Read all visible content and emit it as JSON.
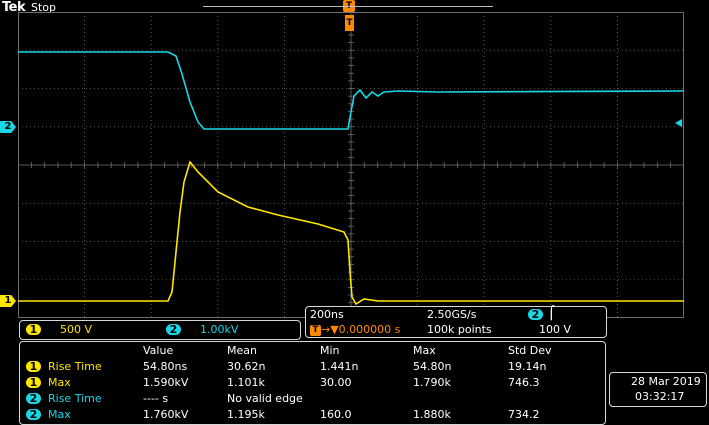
{
  "header": {
    "brand": "Tek",
    "state": "Stop"
  },
  "marker_labels": {
    "trigger": "T",
    "ch1": "1",
    "ch2": "2"
  },
  "channels": [
    {
      "num": "1",
      "scale": "500 V",
      "color": "#ffe600"
    },
    {
      "num": "2",
      "scale": "1.00kV",
      "color": "#18d8e8"
    }
  ],
  "acquisition": {
    "timebase": "200ns",
    "sample_rate": "2.50GS/s",
    "trigger_channel": "2",
    "trigger_slope_icon": "rising-edge-icon",
    "trigger_position": "→▼0.000000 s",
    "record_length": "100k points",
    "trigger_level": "100 V"
  },
  "measurements": {
    "headers": [
      "Value",
      "Mean",
      "Min",
      "Max",
      "Std Dev"
    ],
    "rows": [
      {
        "ch": "1",
        "name": "Rise Time",
        "value": "54.80ns",
        "mean": "30.62n",
        "min": "1.441n",
        "max": "54.80n",
        "std": "19.14n"
      },
      {
        "ch": "1",
        "name": "Max",
        "value": "1.590kV",
        "mean": "1.101k",
        "min": "30.00",
        "max": "1.790k",
        "std": "746.3"
      },
      {
        "ch": "2",
        "name": "Rise Time",
        "value": "---- s",
        "mean": "No valid edge",
        "min": "",
        "max": "",
        "std": ""
      },
      {
        "ch": "2",
        "name": "Max",
        "value": "1.760kV",
        "mean": "1.195k",
        "min": "160.0",
        "max": "1.880k",
        "std": "734.2"
      }
    ]
  },
  "datetime": {
    "date": "28 Mar  2019",
    "time": "03:32:17"
  },
  "colors": {
    "ch1": "#ffe600",
    "ch2": "#18d8e8",
    "trigger": "#ff8a00",
    "grid": "#6e6e6e"
  }
}
